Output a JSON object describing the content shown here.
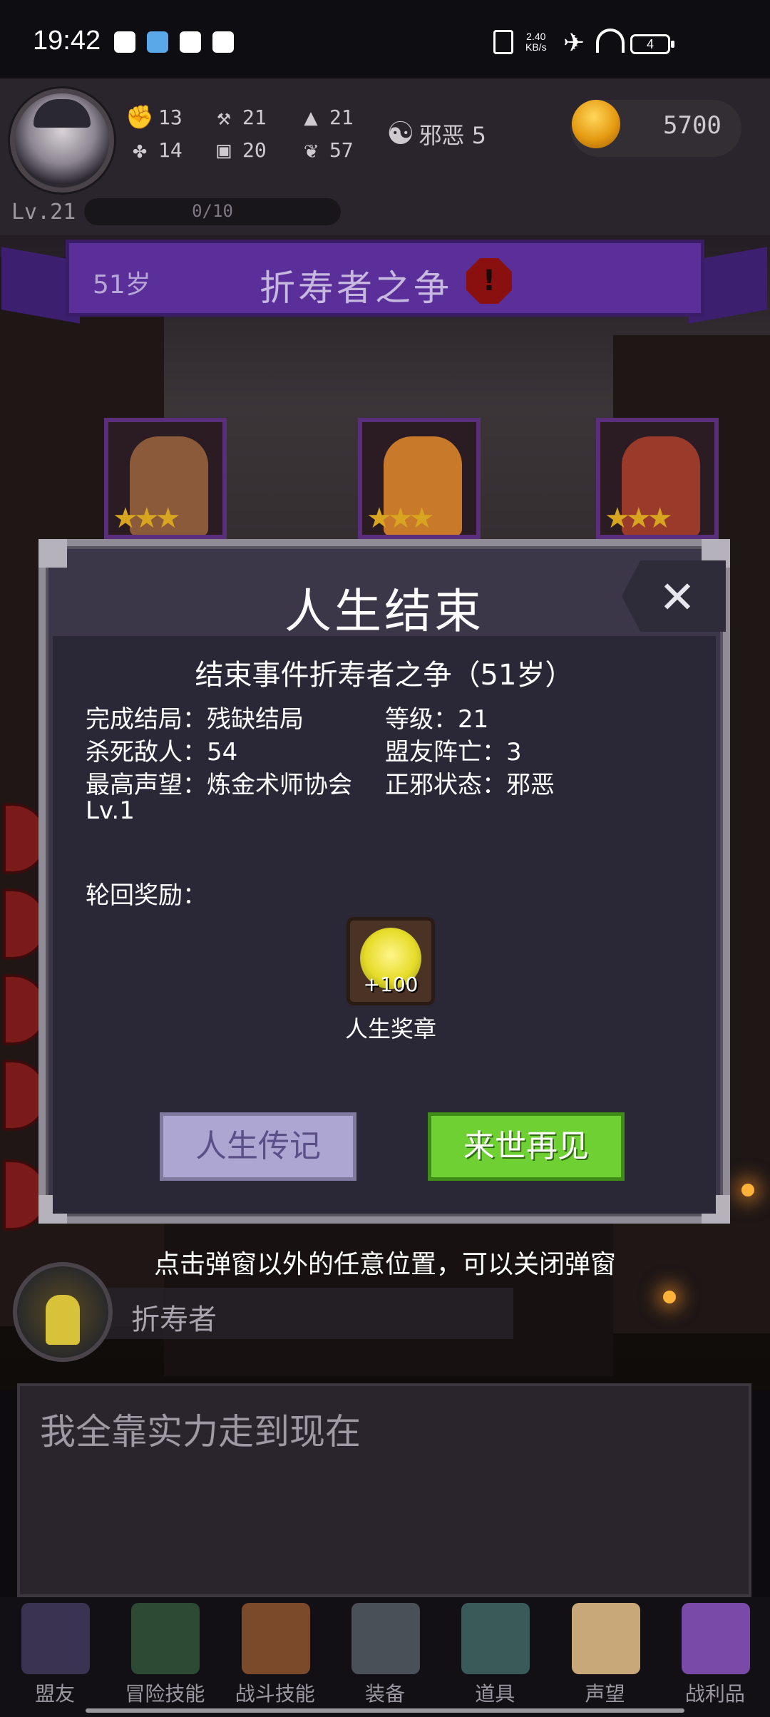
{
  "status_bar": {
    "time": "19:42",
    "net_speed": "2.40",
    "net_unit": "KB/s",
    "battery": "4"
  },
  "header": {
    "stats": [
      {
        "icon": "fist-icon",
        "glyph": "✊",
        "value": "13"
      },
      {
        "icon": "hammer-icon",
        "glyph": "⚒",
        "value": "21"
      },
      {
        "icon": "wizard-hat-icon",
        "glyph": "▲",
        "value": "21"
      },
      {
        "icon": "clover-icon",
        "glyph": "✤",
        "value": "14"
      },
      {
        "icon": "armor-icon",
        "glyph": "▣",
        "value": "20"
      },
      {
        "icon": "wings-icon",
        "glyph": "❦",
        "value": "57"
      }
    ],
    "alignment_label": "邪恶 5",
    "gold": "5700",
    "level": "Lv.21",
    "xp": "0/10"
  },
  "event": {
    "age": "51岁",
    "title": "折寿者之争",
    "warning_glyph": "!"
  },
  "modal": {
    "title": "人生结束",
    "close_glyph": "✕",
    "subtitle": "结束事件折寿者之争（51岁）",
    "ending": "完成结局：残缺结局",
    "level": "等级：21",
    "kills": "杀死敌人：54",
    "allies_lost": "盟友阵亡：3",
    "reputation": "最高声望：炼金术师协会",
    "reputation_lv": "Lv.1",
    "alignment": "正邪状态：邪恶",
    "reward_label": "轮回奖励：",
    "reward_count": "+100",
    "reward_name": "人生奖章",
    "btn_biography": "人生传记",
    "btn_next_life": "来世再见"
  },
  "hint": "点击弹窗以外的任意位置，可以关闭弹窗",
  "dialog": {
    "speaker": "折寿者",
    "text": "我全靠实力走到现在"
  },
  "nav": {
    "items": [
      {
        "label": "盟友",
        "icon": "handshake-icon"
      },
      {
        "label": "冒险技能",
        "icon": "book-icon"
      },
      {
        "label": "战斗技能",
        "icon": "backpack-icon"
      },
      {
        "label": "装备",
        "icon": "swords-icon"
      },
      {
        "label": "道具",
        "icon": "bag-icon"
      },
      {
        "label": "声望",
        "icon": "scroll-icon"
      },
      {
        "label": "战利品",
        "icon": "chest-icon"
      }
    ]
  },
  "colors": {
    "accent_purple": "#5a2f9a",
    "button_green": "#6fd033",
    "button_lavender": "#ada6d2",
    "gold": "#e59a12"
  }
}
